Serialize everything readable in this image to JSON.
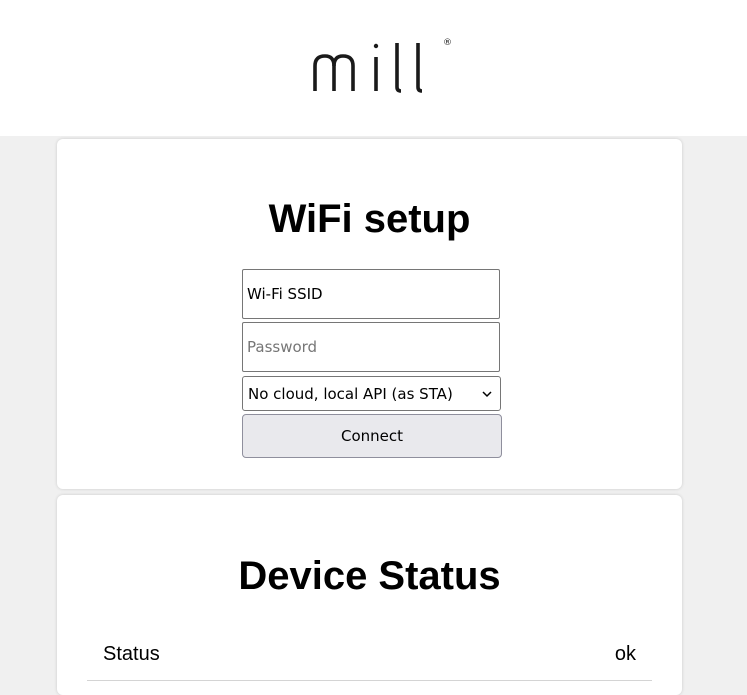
{
  "brand": {
    "logo_text": "mill",
    "registered_mark": "®"
  },
  "wifi_setup": {
    "title": "WiFi setup",
    "ssid_value": "Wi-Fi SSID",
    "password_placeholder": "Password",
    "mode_selected": "No cloud, local API (as STA)",
    "connect_label": "Connect"
  },
  "device_status": {
    "title": "Device Status",
    "rows": [
      {
        "label": "Status",
        "value": "ok"
      }
    ]
  },
  "colors": {
    "background": "#f0f0f0",
    "card": "#ffffff",
    "button": "#e9e9ed",
    "text": "#000000",
    "logo": "#1a1a1a"
  },
  "icons": {
    "select_arrow": "chevron-down-icon"
  }
}
